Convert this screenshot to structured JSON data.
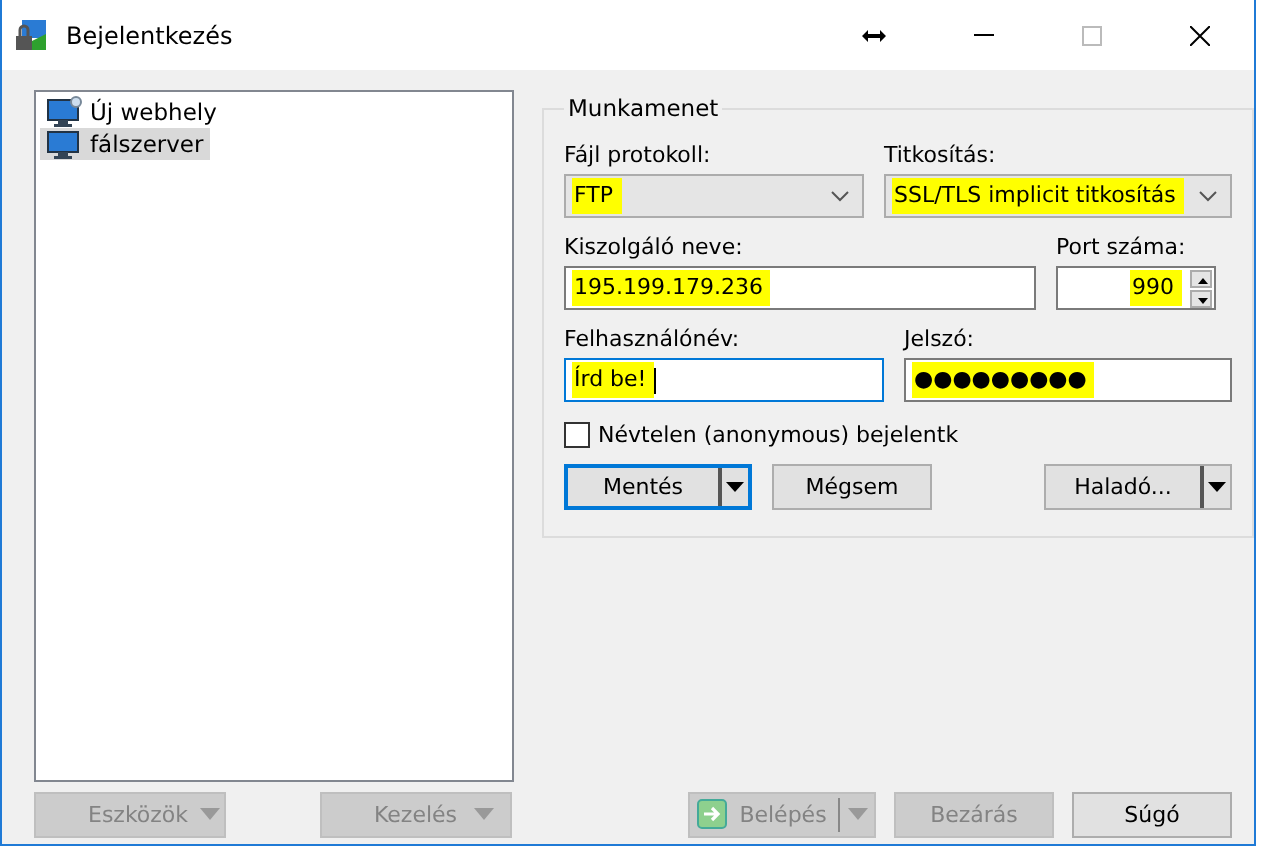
{
  "window": {
    "title": "Bejelentkezés"
  },
  "sites": [
    {
      "label": "Új webhely",
      "kind": "new",
      "selected": false
    },
    {
      "label": "fálszerver",
      "kind": "site",
      "selected": true
    }
  ],
  "session": {
    "title": "Munkamenet",
    "protocol": {
      "label": "Fájl protokoll:",
      "value": "FTP",
      "highlighted": true
    },
    "encryption": {
      "label": "Titkosítás:",
      "value": "SSL/TLS implicit titkosítás",
      "highlighted": true
    },
    "host": {
      "label": "Kiszolgáló neve:",
      "value": "195.199.179.236",
      "highlighted": true
    },
    "port": {
      "label": "Port száma:",
      "value": "990",
      "highlighted": true
    },
    "user": {
      "label": "Felhasználónév:",
      "value": "Írd be!",
      "highlighted": true,
      "focused": true
    },
    "password": {
      "label": "Jelszó:",
      "value": "●●●●●●●●●",
      "highlighted": true
    },
    "anonymous": {
      "label": "Névtelen (anonymous) bejelentk",
      "checked": false
    },
    "buttons": [
      {
        "label": "Mentés",
        "split": true,
        "default": true
      },
      {
        "label": "Mégsem",
        "split": false,
        "default": false
      },
      {
        "label": "Haladó...",
        "split": true,
        "default": false
      }
    ]
  },
  "footer": {
    "left": [
      {
        "label": "Eszközök",
        "disabled": true
      },
      {
        "label": "Kezelés",
        "disabled": true
      }
    ],
    "right": [
      {
        "label": "Belépés",
        "kind": "login",
        "disabled": true
      },
      {
        "label": "Bezárás",
        "kind": "plain",
        "disabled": true
      },
      {
        "label": "Súgó",
        "kind": "plain",
        "disabled": false
      }
    ]
  }
}
